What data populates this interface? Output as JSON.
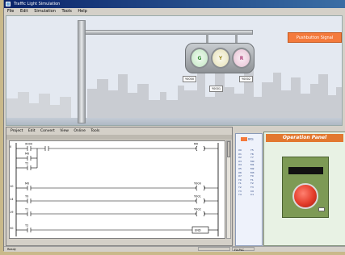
{
  "window": {
    "title": "Traffic Light Simulation"
  },
  "menubar": {
    "items": [
      "File",
      "Edit",
      "Simulation",
      "Tools",
      "Help"
    ]
  },
  "scene": {
    "pushbutton_label": "Pushbutton Signal",
    "lamps": {
      "green": "G",
      "yellow": "Y",
      "red": "R"
    },
    "tags": {
      "green_tag": "Y0000",
      "red_tag": "Y0002",
      "yellow_tag": "Y0001"
    }
  },
  "editor": {
    "menu": [
      "Project",
      "Edit",
      "Convert",
      "View",
      "Online",
      "Tools"
    ],
    "rungs": [
      {
        "step": "0",
        "contact": "X000",
        "coil": "M0"
      },
      {
        "step": "",
        "contact": "M0",
        "coil": ""
      },
      {
        "step": "",
        "contact": "T2",
        "coil": ""
      },
      {
        "step": "10",
        "contact": "M0",
        "coil": "Y000"
      },
      {
        "step": "14",
        "contact": "T0",
        "coil": "Y001"
      },
      {
        "step": "19",
        "contact": "T1",
        "coil": "Y002"
      },
      {
        "step": "30",
        "contact": "T2",
        "coil": "END"
      }
    ],
    "tools": [
      "F5",
      "F6",
      "F7",
      "F8",
      "F9",
      "F10"
    ]
  },
  "devices": {
    "header": "Bits",
    "labels": [
      "X0",
      "X1",
      "X2",
      "X3",
      "X4",
      "X5",
      "X6",
      "X7",
      "Y0",
      "Y1",
      "Y2",
      "Y3",
      "Y4",
      "Y5",
      "Y6",
      "Y7",
      "M0",
      "M1",
      "M2",
      "M3",
      "T0",
      "T1",
      "T2",
      "T3",
      "C0",
      "C1"
    ]
  },
  "operation_panel": {
    "title": "Operation Panel"
  },
  "statusbar": {
    "left": "Ready",
    "right": "FX-PLC"
  }
}
